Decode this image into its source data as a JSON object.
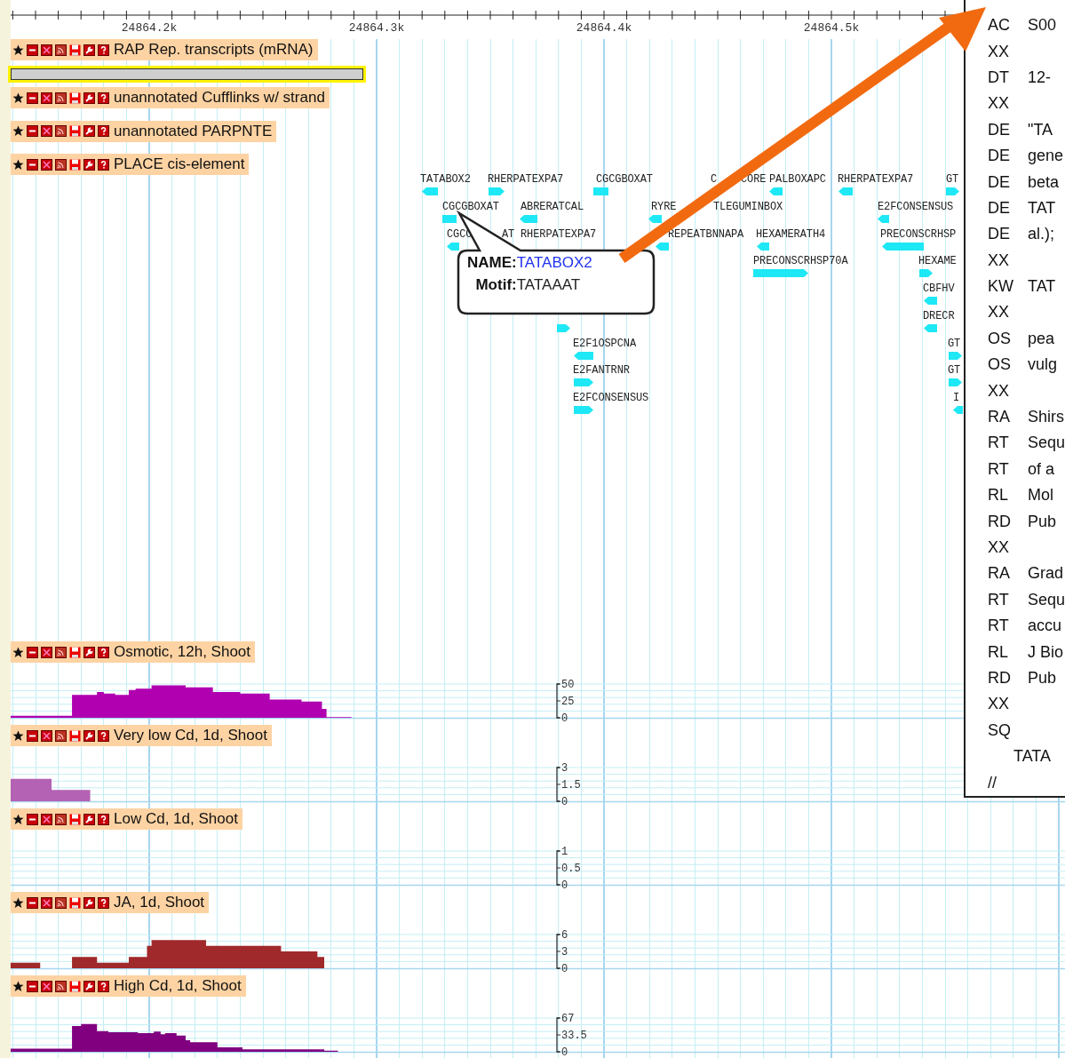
{
  "ruler": {
    "labels": [
      "24864.2k",
      "24864.3k",
      "24864.4k",
      "24864.5k"
    ]
  },
  "tracks": [
    {
      "title": "RAP Rep. transcripts (mRNA)",
      "kind": "transcripts",
      "features": [
        {
          "selected": true
        }
      ]
    },
    {
      "title": "unannotated Cufflinks w/ strand",
      "kind": "empty"
    },
    {
      "title": "unannotated PARPNTE",
      "kind": "empty"
    },
    {
      "title": "PLACE cis-element",
      "kind": "motifs",
      "motifs": [
        {
          "label": "TATABOX2",
          "kind": "leftward"
        },
        {
          "label": "RHERPATEXPA7",
          "kind": "rightward"
        },
        {
          "label": "CGCGBOXAT",
          "kind": "block"
        },
        {
          "label": "C",
          "kind": "bare"
        },
        {
          "label": "CORE",
          "kind": "bare"
        },
        {
          "label": "PALBOXAPC",
          "kind": "leftward"
        },
        {
          "label": "RHERPATEXPA7",
          "kind": "leftward"
        },
        {
          "label": "GT",
          "kind": "rightward"
        },
        {
          "label": "CGCGBOXAT",
          "kind": "block"
        },
        {
          "label": "ABRERATCAL",
          "kind": "leftward"
        },
        {
          "label": "RYRE",
          "kind": "leftward"
        },
        {
          "label": "TLEGUMINBOX",
          "kind": "bare"
        },
        {
          "label": "E2FCONSENSUS",
          "kind": "leftward"
        },
        {
          "label": "CGCC",
          "kind": "leftward"
        },
        {
          "label": "AT",
          "kind": "bare"
        },
        {
          "label": "RHERPATEXPA7",
          "kind": "bare"
        },
        {
          "label": "REPEATBNNAPA",
          "kind": "leftward"
        },
        {
          "label": "HEXAMERATH4",
          "kind": "leftward"
        },
        {
          "label": "PRECONSCRHSP",
          "kind": "leftward"
        },
        {
          "label": "PRECONSCRHSP70A",
          "kind": "rightward"
        },
        {
          "label": "HEXAME",
          "kind": "rightward"
        },
        {
          "label": "CBFHV",
          "kind": "leftward"
        },
        {
          "kind": "rightward"
        },
        {
          "label": "DRECR",
          "kind": "leftward"
        },
        {
          "label": "E2F1OSPCNA",
          "kind": "leftward"
        },
        {
          "label": "GT",
          "kind": "rightward"
        },
        {
          "label": "E2FANTRNR",
          "kind": "rightward"
        },
        {
          "label": "GT",
          "kind": "rightward"
        },
        {
          "label": "E2FCONSENSUS",
          "kind": "rightward"
        },
        {
          "label": "I",
          "kind": "leftward"
        }
      ]
    },
    {
      "title": "Osmotic, 12h, Shoot",
      "kind": "wiggle",
      "color": "#b000b0",
      "scale": [
        "50",
        "25",
        "0"
      ]
    },
    {
      "title": "Very low Cd, 1d, Shoot",
      "kind": "wiggle",
      "color": "#b462b4",
      "scale": [
        "3",
        "1.5",
        "0"
      ]
    },
    {
      "title": "Low Cd, 1d, Shoot",
      "kind": "wiggle",
      "scale": [
        "1",
        "0.5",
        "0"
      ]
    },
    {
      "title": "JA, 1d, Shoot",
      "kind": "wiggle",
      "color": "#a0292b",
      "scale": [
        "6",
        "3",
        "0"
      ]
    },
    {
      "title": "High Cd, 1d, Shoot",
      "kind": "wiggle",
      "color": "#800080",
      "scale": [
        "67",
        "33.5",
        "0"
      ]
    }
  ],
  "popup": {
    "fields": [
      {
        "label": "NAME:",
        "value": "TATABOX2",
        "kind": "link"
      },
      {
        "label": "Motif:",
        "value": "TATAAAT",
        "kind": "text"
      }
    ]
  },
  "entry_panel": {
    "lines": [
      {
        "code": "AC",
        "text": "S00"
      },
      {
        "code": "XX"
      },
      {
        "code": "DT",
        "text": "12-"
      },
      {
        "code": "XX"
      },
      {
        "code": "DE",
        "text": "\"TA"
      },
      {
        "code": "DE",
        "text": "gene"
      },
      {
        "code": "DE",
        "text": "beta"
      },
      {
        "code": "DE",
        "text": "TAT"
      },
      {
        "code": "DE",
        "text": "al.);"
      },
      {
        "code": "XX"
      },
      {
        "code": "KW",
        "text": "TAT"
      },
      {
        "code": "XX"
      },
      {
        "code": "OS",
        "text": "pea"
      },
      {
        "code": "OS",
        "text": "vulg"
      },
      {
        "code": "XX"
      },
      {
        "code": "RA",
        "text": "Shirs"
      },
      {
        "code": "RT",
        "text": "Sequ"
      },
      {
        "code": "RT",
        "text": "of a"
      },
      {
        "code": "RL",
        "text": "Mol"
      },
      {
        "code": "RD",
        "text": "Pub"
      },
      {
        "code": "XX"
      },
      {
        "code": "RA",
        "text": "Grad"
      },
      {
        "code": "RT",
        "text": "Sequ"
      },
      {
        "code": "RT",
        "text": "accu"
      },
      {
        "code": "RL",
        "text": "J Bio"
      },
      {
        "code": "RD",
        "text": "Pub"
      },
      {
        "code": "XX"
      },
      {
        "code": "SQ"
      },
      {
        "sequence": "TATA"
      },
      {
        "code": "//"
      }
    ]
  }
}
